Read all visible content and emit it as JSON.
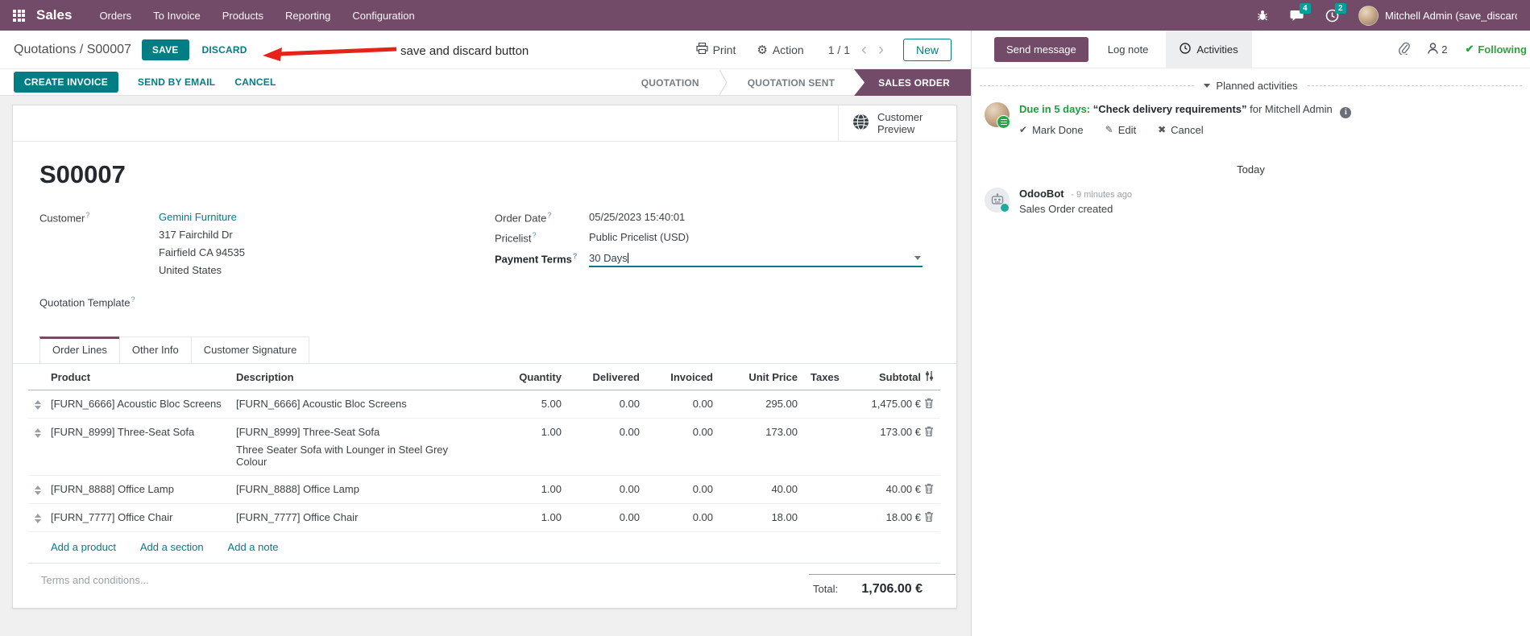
{
  "colors": {
    "topbar": "#714B67",
    "accent_teal": "#017E84",
    "badge_teal": "#00A09D",
    "status_active": "#714B67",
    "modified_blue": "#0a7fc0",
    "due_green": "#1f9d3f",
    "following_green": "#28a745",
    "annotation_red": "#e8221a"
  },
  "icons": {
    "gear": "⚙",
    "chevron_left": "‹",
    "chevron_right": "›",
    "check": "✔",
    "pencil": "✎",
    "close": "✖",
    "info": "i"
  },
  "topbar": {
    "app": "Sales",
    "menus": [
      "Orders",
      "To Invoice",
      "Products",
      "Reporting",
      "Configuration"
    ],
    "message_badge": "4",
    "activity_badge": "2",
    "user": "Mitchell Admin (save_discard"
  },
  "breadcrumb": {
    "parent": "Quotations",
    "separator": " / ",
    "current": "S00007",
    "save": "SAVE",
    "discard": "DISCARD"
  },
  "annotation": {
    "text": "save and discard button"
  },
  "pager": {
    "print": "Print",
    "action": "Action",
    "counter": "1 / 1",
    "new": "New"
  },
  "statusbar": {
    "buttons": [
      "CREATE INVOICE",
      "SEND BY EMAIL",
      "CANCEL"
    ],
    "steps": [
      "QUOTATION",
      "QUOTATION SENT",
      "SALES ORDER"
    ]
  },
  "form": {
    "name": "S00007",
    "customer_preview": {
      "line1": "Customer",
      "line2": "Preview"
    },
    "help_marker": "?",
    "customer_label": "Customer",
    "customer_name": "Gemini Furniture",
    "address": [
      "317 Fairchild Dr",
      "Fairfield CA 94535",
      "United States"
    ],
    "quotation_template_label": "Quotation Template",
    "order_date_label": "Order Date",
    "order_date": "05/25/2023 15:40:01",
    "pricelist_label": "Pricelist",
    "pricelist": "Public Pricelist (USD)",
    "payment_terms_label": "Payment Terms",
    "payment_terms": "30 Days",
    "tabs": [
      "Order Lines",
      "Other Info",
      "Customer Signature"
    ],
    "table": {
      "headers": {
        "product": "Product",
        "description": "Description",
        "quantity": "Quantity",
        "delivered": "Delivered",
        "invoiced": "Invoiced",
        "unit_price": "Unit Price",
        "taxes": "Taxes",
        "subtotal": "Subtotal"
      },
      "rows": [
        {
          "product": "[FURN_6666] Acoustic Bloc Screens",
          "description": "[FURN_6666] Acoustic Bloc Screens",
          "description2": "",
          "quantity": "5.00",
          "delivered": "0.00",
          "invoiced": "0.00",
          "unit_price": "295.00",
          "taxes": "",
          "subtotal": "1,475.00 €"
        },
        {
          "product": "[FURN_8999] Three-Seat Sofa",
          "description": "[FURN_8999] Three-Seat Sofa",
          "description2": "Three Seater Sofa with Lounger in Steel Grey Colour",
          "quantity": "1.00",
          "delivered": "0.00",
          "invoiced": "0.00",
          "unit_price": "173.00",
          "taxes": "",
          "subtotal": "173.00 €"
        },
        {
          "product": "[FURN_8888] Office Lamp",
          "description": "[FURN_8888] Office Lamp",
          "description2": "",
          "quantity": "1.00",
          "delivered": "0.00",
          "invoiced": "0.00",
          "unit_price": "40.00",
          "taxes": "",
          "subtotal": "40.00 €"
        },
        {
          "product": "[FURN_7777] Office Chair",
          "description": "[FURN_7777] Office Chair",
          "description2": "",
          "quantity": "1.00",
          "delivered": "0.00",
          "invoiced": "0.00",
          "unit_price": "18.00",
          "taxes": "",
          "subtotal": "18.00 €"
        }
      ],
      "links": [
        "Add a product",
        "Add a section",
        "Add a note"
      ]
    },
    "terms_placeholder": "Terms and conditions...",
    "total_label": "Total:",
    "total_value": "1,706.00 €"
  },
  "chatter": {
    "send_message": "Send message",
    "log_note": "Log note",
    "activities": "Activities",
    "followers_count": "2",
    "following": "Following",
    "planned_header": "Planned activities",
    "activity": {
      "due": "Due in 5 days:",
      "title": "“Check delivery requirements”",
      "for_text": "for Mitchell Admin",
      "mark_done": "Mark Done",
      "edit": "Edit",
      "cancel": "Cancel"
    },
    "today": "Today",
    "message": {
      "author": "OdooBot",
      "time": "- 9 minutes ago",
      "body": "Sales Order created"
    }
  }
}
